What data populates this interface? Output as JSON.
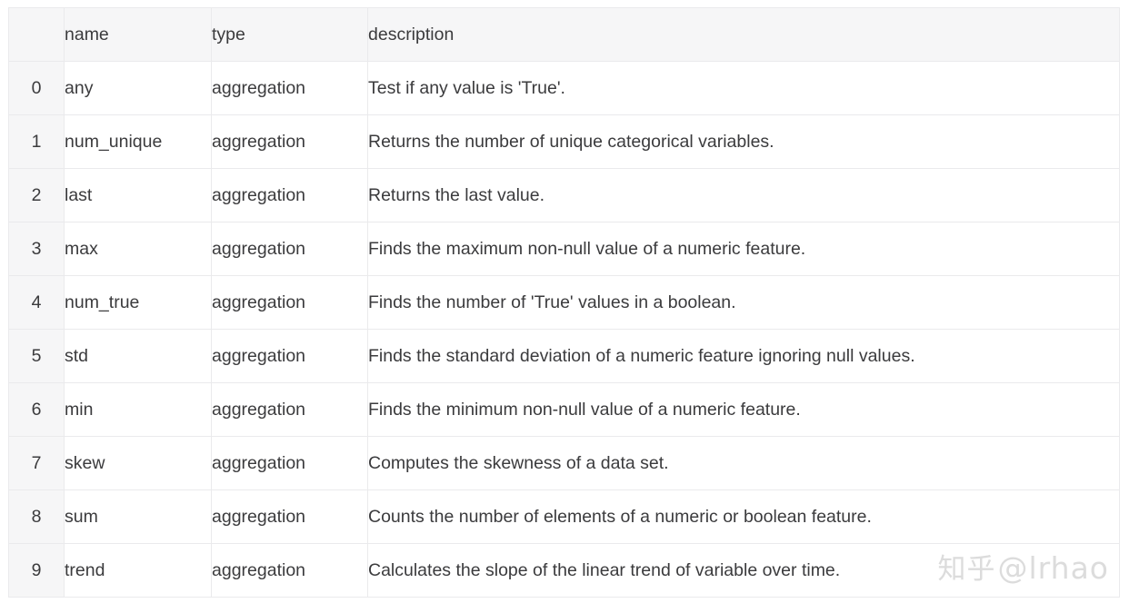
{
  "table": {
    "index_header": "",
    "columns": [
      "name",
      "type",
      "description"
    ],
    "rows": [
      {
        "index": "0",
        "name": "any",
        "type": "aggregation",
        "description": "Test if any value is 'True'."
      },
      {
        "index": "1",
        "name": "num_unique",
        "type": "aggregation",
        "description": "Returns the number of unique categorical variables."
      },
      {
        "index": "2",
        "name": "last",
        "type": "aggregation",
        "description": "Returns the last value."
      },
      {
        "index": "3",
        "name": "max",
        "type": "aggregation",
        "description": "Finds the maximum non-null value of a numeric feature."
      },
      {
        "index": "4",
        "name": "num_true",
        "type": "aggregation",
        "description": "Finds the number of 'True' values in a boolean."
      },
      {
        "index": "5",
        "name": "std",
        "type": "aggregation",
        "description": "Finds the standard deviation of a numeric feature ignoring null values."
      },
      {
        "index": "6",
        "name": "min",
        "type": "aggregation",
        "description": "Finds the minimum non-null value of a numeric feature."
      },
      {
        "index": "7",
        "name": "skew",
        "type": "aggregation",
        "description": "Computes the skewness of a data set."
      },
      {
        "index": "8",
        "name": "sum",
        "type": "aggregation",
        "description": "Counts the number of elements of a numeric or boolean feature."
      },
      {
        "index": "9",
        "name": "trend",
        "type": "aggregation",
        "description": "Calculates the slope of the linear trend of variable over time."
      }
    ]
  },
  "watermark": {
    "site": "知乎",
    "handle": "@lrhao"
  },
  "colors": {
    "header_background": "#f6f6f7",
    "cell_background": "#ffffff",
    "border": "#eaeaec",
    "text": "#3b3b3d",
    "watermark": "#dcdcdc"
  }
}
